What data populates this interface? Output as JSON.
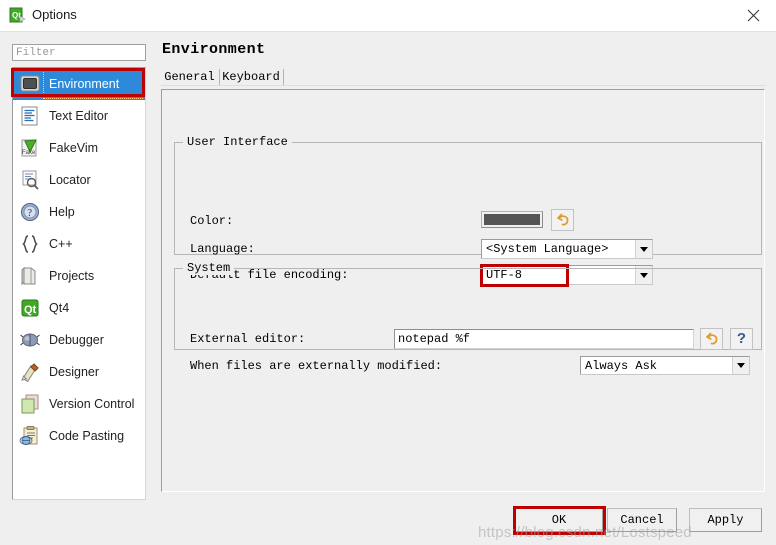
{
  "window": {
    "title": "Options",
    "icon": "qt-creator-icon",
    "close_label": "close-icon"
  },
  "sidebar": {
    "filter_placeholder": "Filter",
    "filter_value": "",
    "items": [
      {
        "label": "Environment",
        "icon": "monitor-icon",
        "selected": true
      },
      {
        "label": "Text Editor",
        "icon": "text-document-icon",
        "selected": false
      },
      {
        "label": "FakeVim",
        "icon": "fakevim-icon",
        "selected": false
      },
      {
        "label": "Locator",
        "icon": "magnifier-doc-icon",
        "selected": false
      },
      {
        "label": "Help",
        "icon": "question-ball-icon",
        "selected": false
      },
      {
        "label": "C++",
        "icon": "braces-icon",
        "selected": false
      },
      {
        "label": "Projects",
        "icon": "folder-open-icon",
        "selected": false
      },
      {
        "label": "Qt4",
        "icon": "qt-logo-icon",
        "selected": false
      },
      {
        "label": "Debugger",
        "icon": "bug-icon",
        "selected": false
      },
      {
        "label": "Designer",
        "icon": "pencil-ruler-icon",
        "selected": false
      },
      {
        "label": "Version Control",
        "icon": "copy-pages-icon",
        "selected": false
      },
      {
        "label": "Code Pasting",
        "icon": "clipboard-globe-icon",
        "selected": false
      }
    ]
  },
  "page": {
    "title": "Environment",
    "tabs": [
      {
        "label": "General",
        "active": true
      },
      {
        "label": "Keyboard",
        "active": false
      }
    ]
  },
  "user_interface": {
    "group_title": "User Interface",
    "color_label": "Color:",
    "color_value": "#555555",
    "color_reset_icon": "undo-arrow-icon",
    "language_label": "Language:",
    "language_value": "<System Language>",
    "encoding_label": "Default file encoding:",
    "encoding_value": "UTF-8"
  },
  "system": {
    "group_title": "System",
    "editor_label": "External editor:",
    "editor_value": "notepad %f",
    "editor_reset_icon": "undo-arrow-icon",
    "editor_help_label": "?",
    "modified_label": "When files are externally modified:",
    "modified_value": "Always Ask"
  },
  "buttons": {
    "ok": "OK",
    "cancel": "Cancel",
    "apply": "Apply"
  },
  "watermark": "https://blog.csdn.net/Lostspeed",
  "colors": {
    "selection": "#2e8ad8",
    "highlight_box": "#c00000",
    "window_bg": "#efefef"
  }
}
